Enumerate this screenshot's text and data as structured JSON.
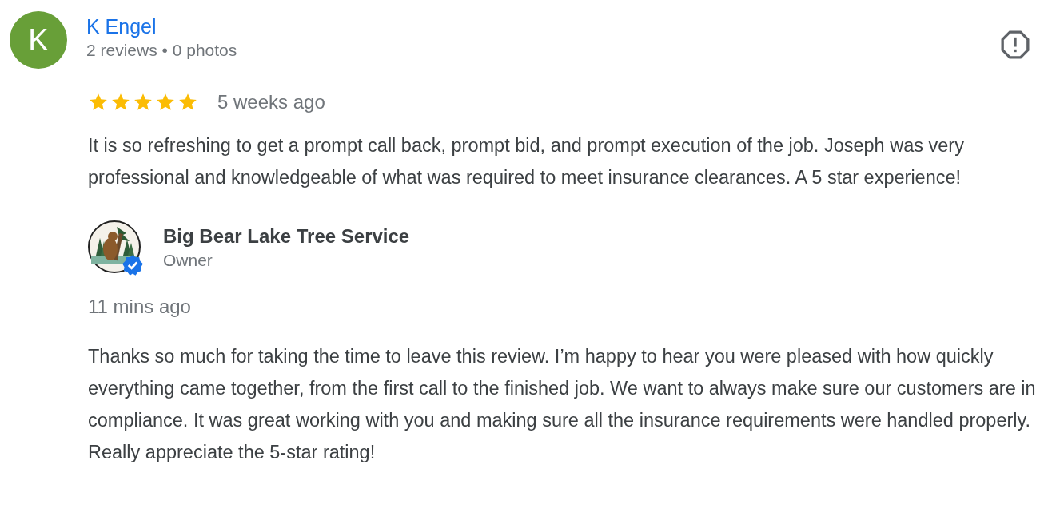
{
  "reviewer": {
    "initial": "K",
    "name": "K Engel",
    "stats": "2 reviews • 0 photos"
  },
  "review": {
    "stars": 5,
    "time": "5 weeks ago",
    "text": "It is so refreshing to get a prompt call back, prompt bid, and prompt execution of the job. Joseph was very professional and knowledgeable of what was required to meet insurance clearances. A 5 star experience!"
  },
  "owner_reply": {
    "name": "Big Bear Lake Tree Service",
    "role": "Owner",
    "verified": true,
    "time": "11 mins ago",
    "text": "Thanks so much for taking the time to leave this review. I’m happy to hear you were pleased with how quickly everything came together, from the first call to the finished job. We want to always make sure our customers are in compliance. It was great working with you and making sure all the insurance requirements were handled properly. Really appreciate the 5-star rating!"
  }
}
